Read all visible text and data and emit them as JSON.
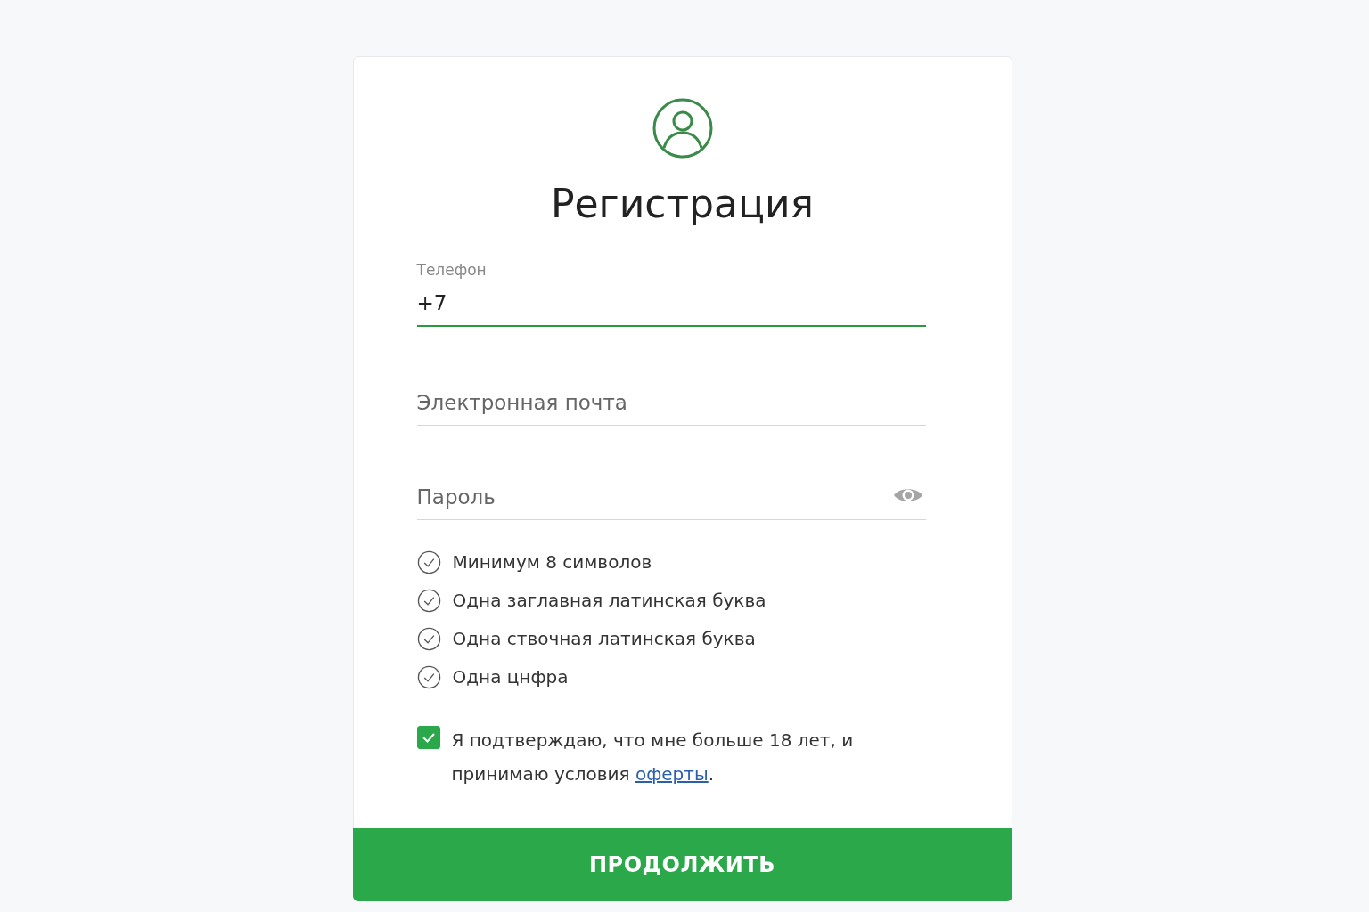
{
  "header": {
    "title": "Регистрация"
  },
  "fields": [
    {
      "kind": "text",
      "label": "Телефон",
      "value": "+7",
      "focused": true
    },
    {
      "kind": "text",
      "placeholder": "Электронная почта",
      "focused": false
    },
    {
      "kind": "password",
      "placeholder": "Пароль",
      "focused": false
    }
  ],
  "requirements": [
    {
      "text": "Минимум 8 символов"
    },
    {
      "text": "Одна заглавная латинская буква"
    },
    {
      "text": "Одна cтвочная латинская буква"
    },
    {
      "text": "Одна цнфра"
    }
  ],
  "consent": {
    "checked": true,
    "text": "Я подтверждаю, что мне больше 18 лет, и принимаю условия ",
    "link": "оферты",
    "after": "."
  },
  "submit": {
    "label": "ПРОДОЛЖИТЬ"
  }
}
